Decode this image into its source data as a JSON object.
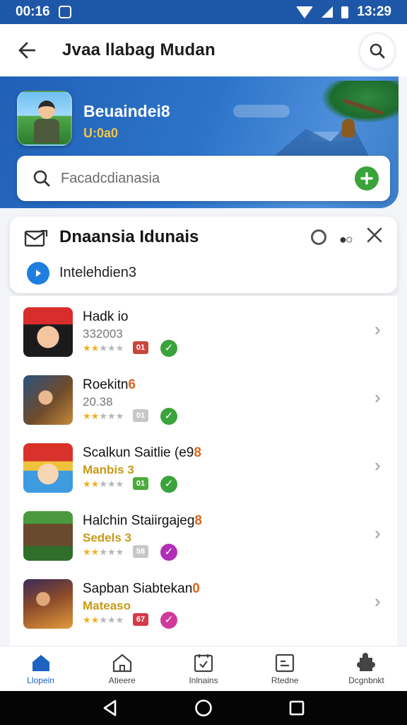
{
  "status_bar": {
    "time_left": "00:16",
    "time_right": "13:29"
  },
  "app_bar": {
    "title": "Jvaa llabag Mudan"
  },
  "banner": {
    "title": "Beuaindei8",
    "subtitle": "U:0a0",
    "search_placeholder": "Facadcdianasia"
  },
  "notification_card": {
    "title": "Dnaansia Idunais",
    "subtitle": "Intelehdien3"
  },
  "list_items": [
    {
      "title": "Hadk io",
      "title_suffix": "",
      "subtitle": "332003",
      "rating": 2,
      "badge": "01",
      "badge_color": "#c9463d",
      "check_color": "#3aa33c",
      "thumb": "red-hat-kid"
    },
    {
      "title": "Roekitn",
      "title_suffix": "6",
      "subtitle": "20.38",
      "rating": 2,
      "badge": "01",
      "badge_color": "#c7c7c7",
      "check_color": "#3aa33c",
      "thumb": "scientist-board"
    },
    {
      "title": "Scalkun Saitlie (e9",
      "title_suffix": "8",
      "subtitle": "Manbis 3",
      "rating": 2,
      "badge": "01",
      "badge_color": "#4bab3b",
      "check_color": "#3aa33c",
      "thumb": "red-hood-girl"
    },
    {
      "title": "Halchin Staiirgajeg",
      "title_suffix": "8",
      "subtitle": "Sedels 3",
      "rating": 2,
      "badge": "58",
      "badge_color": "#c7c7c7",
      "check_color": "#b02fb6",
      "thumb": "hunter-scene"
    },
    {
      "title": "Sapban Siabtekan",
      "title_suffix": "0",
      "subtitle": "Mateaso",
      "rating": 2,
      "badge": "67",
      "badge_color": "#d53a4a",
      "check_color": "#d03a9a",
      "thumb": "warrior-sunset"
    }
  ],
  "bottom_nav": [
    {
      "label": "Llopein",
      "icon": "home-filled-icon"
    },
    {
      "label": "Atieere",
      "icon": "home-outline-icon"
    },
    {
      "label": "Inlnains",
      "icon": "calendar-check-icon"
    },
    {
      "label": "Rtedne",
      "icon": "document-icon"
    },
    {
      "label": "Dcgnbnkt",
      "icon": "puzzle-icon"
    }
  ],
  "colors": {
    "primary": "#1f57a8",
    "accent_green": "#3aa33c",
    "accent_blue": "#1f7fe0"
  }
}
